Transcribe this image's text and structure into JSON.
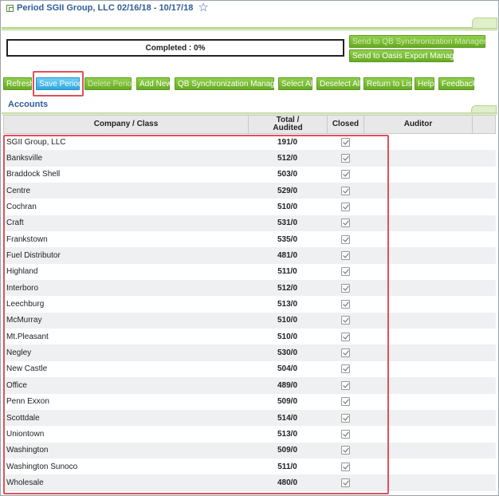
{
  "header": {
    "title": "Period SGII Group, LLC 02/16/18 - 10/17/18",
    "star_icon": "star-icon"
  },
  "progress": {
    "text": "Completed : 0%",
    "percent": 0
  },
  "export_buttons": {
    "qb_sync": "Send to QB Synchronization Manager",
    "oasis": "Send to Oasis Export Manager"
  },
  "toolbar": {
    "refresh": "Refresh",
    "save_period": "Save Period",
    "delete_period": "Delete Period",
    "add_new": "Add New",
    "qb_sync_manager": "QB Synchronization Manager",
    "select_all": "Select All",
    "deselect_all": "Deselect All",
    "return_to_list": "Return to List",
    "help": "Help",
    "feedback": "Feedback"
  },
  "section": {
    "title": "Accounts"
  },
  "table": {
    "columns": {
      "company": "Company / Class",
      "total": "Total /",
      "audited": "Audited",
      "closed": "Closed",
      "auditor": "Auditor"
    },
    "rows": [
      {
        "name": "SGII Group, LLC",
        "total": "191/0",
        "closed": true
      },
      {
        "name": "Banksville",
        "total": "512/0",
        "closed": true
      },
      {
        "name": "Braddock Shell",
        "total": "503/0",
        "closed": true
      },
      {
        "name": "Centre",
        "total": "529/0",
        "closed": true
      },
      {
        "name": "Cochran",
        "total": "510/0",
        "closed": true
      },
      {
        "name": "Craft",
        "total": "531/0",
        "closed": true
      },
      {
        "name": "Frankstown",
        "total": "535/0",
        "closed": true
      },
      {
        "name": "Fuel Distributor",
        "total": "481/0",
        "closed": true
      },
      {
        "name": "Highland",
        "total": "511/0",
        "closed": true
      },
      {
        "name": "Interboro",
        "total": "512/0",
        "closed": true
      },
      {
        "name": "Leechburg",
        "total": "513/0",
        "closed": true
      },
      {
        "name": "McMurray",
        "total": "510/0",
        "closed": true
      },
      {
        "name": "Mt.Pleasant",
        "total": "510/0",
        "closed": true
      },
      {
        "name": "Negley",
        "total": "530/0",
        "closed": true
      },
      {
        "name": "New Castle",
        "total": "504/0",
        "closed": true
      },
      {
        "name": "Office",
        "total": "489/0",
        "closed": true
      },
      {
        "name": "Penn Exxon",
        "total": "509/0",
        "closed": true
      },
      {
        "name": "Scottdale",
        "total": "514/0",
        "closed": true
      },
      {
        "name": "Uniontown",
        "total": "513/0",
        "closed": true
      },
      {
        "name": "Washington",
        "total": "509/0",
        "closed": true
      },
      {
        "name": "Washington Sunoco",
        "total": "511/0",
        "closed": true
      },
      {
        "name": "Wholesale",
        "total": "480/0",
        "closed": true
      }
    ]
  },
  "colors": {
    "accent_green": "#7ab648",
    "title_blue": "#2f5c9c",
    "highlight_red": "#e0515a",
    "active_blue": "#2fa9df"
  }
}
